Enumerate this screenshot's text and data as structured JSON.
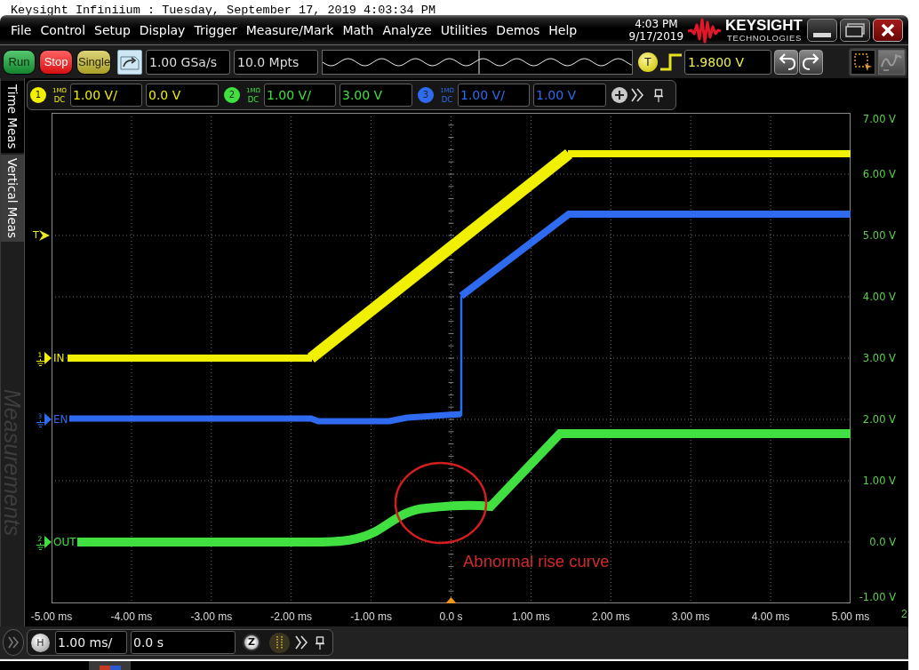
{
  "window": {
    "title": "Keysight Infiniium : Tuesday, September 17, 2019 4:03:34 PM"
  },
  "menu": [
    "File",
    "Control",
    "Setup",
    "Display",
    "Trigger",
    "Measure/Mark",
    "Math",
    "Analyze",
    "Utilities",
    "Demos",
    "Help"
  ],
  "clock": {
    "time": "4:03 PM",
    "date": "9/17/2019"
  },
  "logo": {
    "brand": "KEYSIGHT",
    "tagline": "TECHNOLOGIES"
  },
  "toolbar": {
    "run_controls": [
      {
        "label": "Run",
        "kind": "run"
      },
      {
        "label": "Stop",
        "kind": "stop"
      },
      {
        "label": "Single",
        "kind": "single"
      }
    ],
    "sample_rate": "1.00 GSa/s",
    "memory_depth": "10.0 Mpts",
    "trigger": {
      "source": "T",
      "level": "1.9800 V"
    }
  },
  "channels": [
    {
      "number": "1",
      "impedance": "1MΩ",
      "coupling": "DC",
      "scale": "1.00 V/",
      "offset": "0.0 V",
      "color": "#f0f000"
    },
    {
      "number": "2",
      "impedance": "1MΩ",
      "coupling": "DC",
      "scale": "1.00 V/",
      "offset": "3.00 V",
      "color": "#40e040"
    },
    {
      "number": "3",
      "impedance": "1MΩ",
      "coupling": "DC",
      "scale": "1.00 V/",
      "offset": "1.00 V",
      "color": "#2f6bf0"
    }
  ],
  "sidebar": {
    "tabs": [
      {
        "label": "Time Meas",
        "selected": true
      },
      {
        "label": "Vertical Meas",
        "selected": false
      }
    ],
    "panel_title": "Measurements"
  },
  "display": {
    "trigger_marker": "T",
    "y_axis_labels": [
      "7.00 V",
      "6.00 V",
      "5.00 V",
      "4.00 V",
      "3.00 V",
      "2.00 V",
      "1.00 V",
      "0.0 V",
      "-1.00 V"
    ],
    "traces": [
      {
        "label": "IN",
        "channel": "1",
        "color": "#f0f000"
      },
      {
        "label": "EN",
        "channel": "3",
        "color": "#2f6bf0"
      },
      {
        "label": "OUT",
        "channel": "2",
        "color": "#40e040"
      }
    ],
    "y_axis_channel": "2",
    "x_axis_labels": [
      "-5.00 ms",
      "-4.00 ms",
      "-3.00 ms",
      "-2.00 ms",
      "-1.00 ms",
      "0.0 s",
      "1.00 ms",
      "2.00 ms",
      "3.00 ms",
      "4.00 ms",
      "5.00 ms"
    ],
    "annotation": "Abnormal rise curve"
  },
  "horizontal": {
    "label": "H",
    "scale": "1.00 ms/",
    "position": "0.0 s",
    "zoom_label": "Z"
  }
}
